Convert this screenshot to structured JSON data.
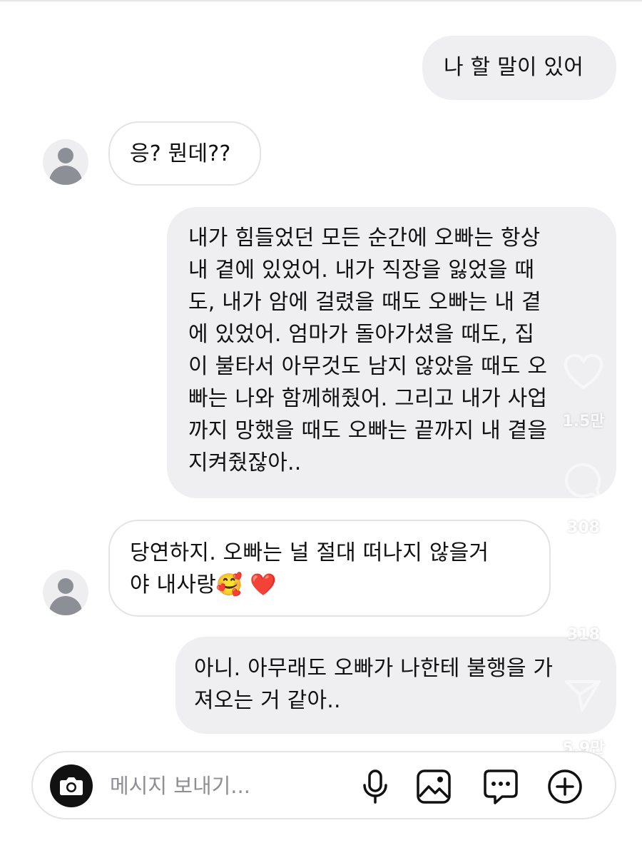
{
  "messages": [
    {
      "direction": "out",
      "lines": [
        "나 할 말이 있어"
      ]
    },
    {
      "direction": "in",
      "lines": [
        "응? 뭔데??"
      ]
    },
    {
      "direction": "out",
      "lines": [
        "내가 힘들었던 모든 순간에 오빠는 항상",
        "내 곁에 있었어. 내가 직장을 잃었을 때",
        "도, 내가 암에 걸렸을 때도 오빠는 내 곁",
        "에 있었어. 엄마가 돌아가셨을 때도, 집",
        "이 불타서 아무것도 남지 않았을 때도 오",
        "빠는 나와 함께해줬어. 그리고 내가 사업",
        "까지 망했을 때도 오빠는 끝까지 내 곁을",
        "지켜줬잖아.."
      ]
    },
    {
      "direction": "in",
      "lines": [
        "당연하지. 오빠는 널 절대 떠나지 않을거",
        "야 내사랑🥰 ❤️"
      ]
    },
    {
      "direction": "out",
      "lines": [
        "아니. 아무래도 오빠가 나한테 불행을 가",
        "져오는 거 같아.."
      ]
    }
  ],
  "composer": {
    "placeholder": "메시지 보내기..."
  },
  "icons": {
    "camera": "camera-icon",
    "mic": "microphone-icon",
    "gallery": "image-gallery-icon",
    "sticker": "chat-sticker-icon",
    "plus": "add-circle-icon",
    "avatar": "default-avatar-icon"
  },
  "overlay": {
    "like_count": "1.5만",
    "comment_count": "308",
    "repost_count": "318",
    "share_count": "5.9만"
  }
}
